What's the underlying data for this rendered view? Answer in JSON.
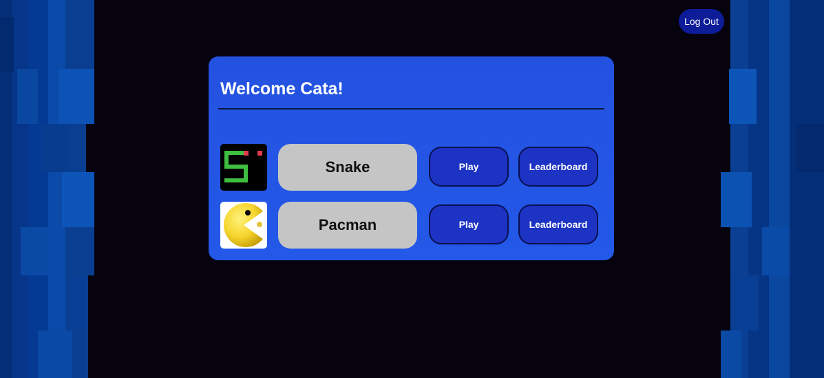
{
  "header": {
    "logout_label": "Log Out"
  },
  "panel": {
    "welcome": "Welcome Cata!"
  },
  "games": [
    {
      "name": "Snake",
      "play_label": "Play",
      "leaderboard_label": "Leaderboard",
      "icon": "snake-game-icon"
    },
    {
      "name": "Pacman",
      "play_label": "Play",
      "leaderboard_label": "Leaderboard",
      "icon": "pacman-icon"
    }
  ],
  "colors": {
    "background": "#06030f",
    "panel": "#2452e0",
    "button": "#1c33c4",
    "name_pill": "#c5c5c5",
    "logout": "#0d1c98",
    "side_stripes": "#0a3a8c"
  }
}
